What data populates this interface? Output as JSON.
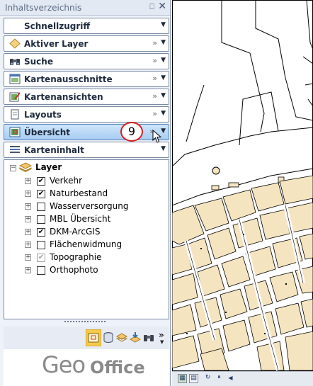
{
  "panel": {
    "title": "Inhaltsverzeichnis",
    "pin": "⎕",
    "close": "✕"
  },
  "sections": [
    {
      "label": "Schnellzugriff",
      "icon": "",
      "has_double": false
    },
    {
      "label": "Aktiver Layer",
      "icon": "diamond-icon",
      "has_double": true
    },
    {
      "label": "Suche",
      "icon": "binoculars-icon",
      "has_double": true
    },
    {
      "label": "Kartenausschnitte",
      "icon": "map-window-icon",
      "has_double": true
    },
    {
      "label": "Kartenansichten",
      "icon": "map-edit-icon",
      "has_double": true
    },
    {
      "label": "Layouts",
      "icon": "page-icon",
      "has_double": true
    },
    {
      "label": "Übersicht",
      "icon": "overview-icon",
      "has_double": true
    },
    {
      "label": "Karteninhalt",
      "icon": "list-icon",
      "has_double": false
    }
  ],
  "glyphs": {
    "double": "»",
    "dropdown": "▼",
    "check": "✔",
    "plus": "+",
    "minus": "−",
    "more": "»"
  },
  "callout_number": "9",
  "tree": {
    "root": "Layer",
    "layers": [
      {
        "label": "Verkehr",
        "checked": true,
        "grey": false
      },
      {
        "label": "Naturbestand",
        "checked": true,
        "grey": false
      },
      {
        "label": "Wasserversorgung",
        "checked": false,
        "grey": false
      },
      {
        "label": "MBL Übersicht",
        "checked": false,
        "grey": false
      },
      {
        "label": "DKM-ArcGIS",
        "checked": true,
        "grey": false
      },
      {
        "label": "Flächenwidmung",
        "checked": false,
        "grey": false
      },
      {
        "label": "Topographie",
        "checked": true,
        "grey": true
      },
      {
        "label": "Orthophoto",
        "checked": false,
        "grey": false
      }
    ]
  },
  "logo": {
    "part1": "Geo",
    "part2": "Office"
  },
  "colors": {
    "accent": "#a7cdf2",
    "callout": "#d92020",
    "building_fill": "#f5e4c0"
  }
}
